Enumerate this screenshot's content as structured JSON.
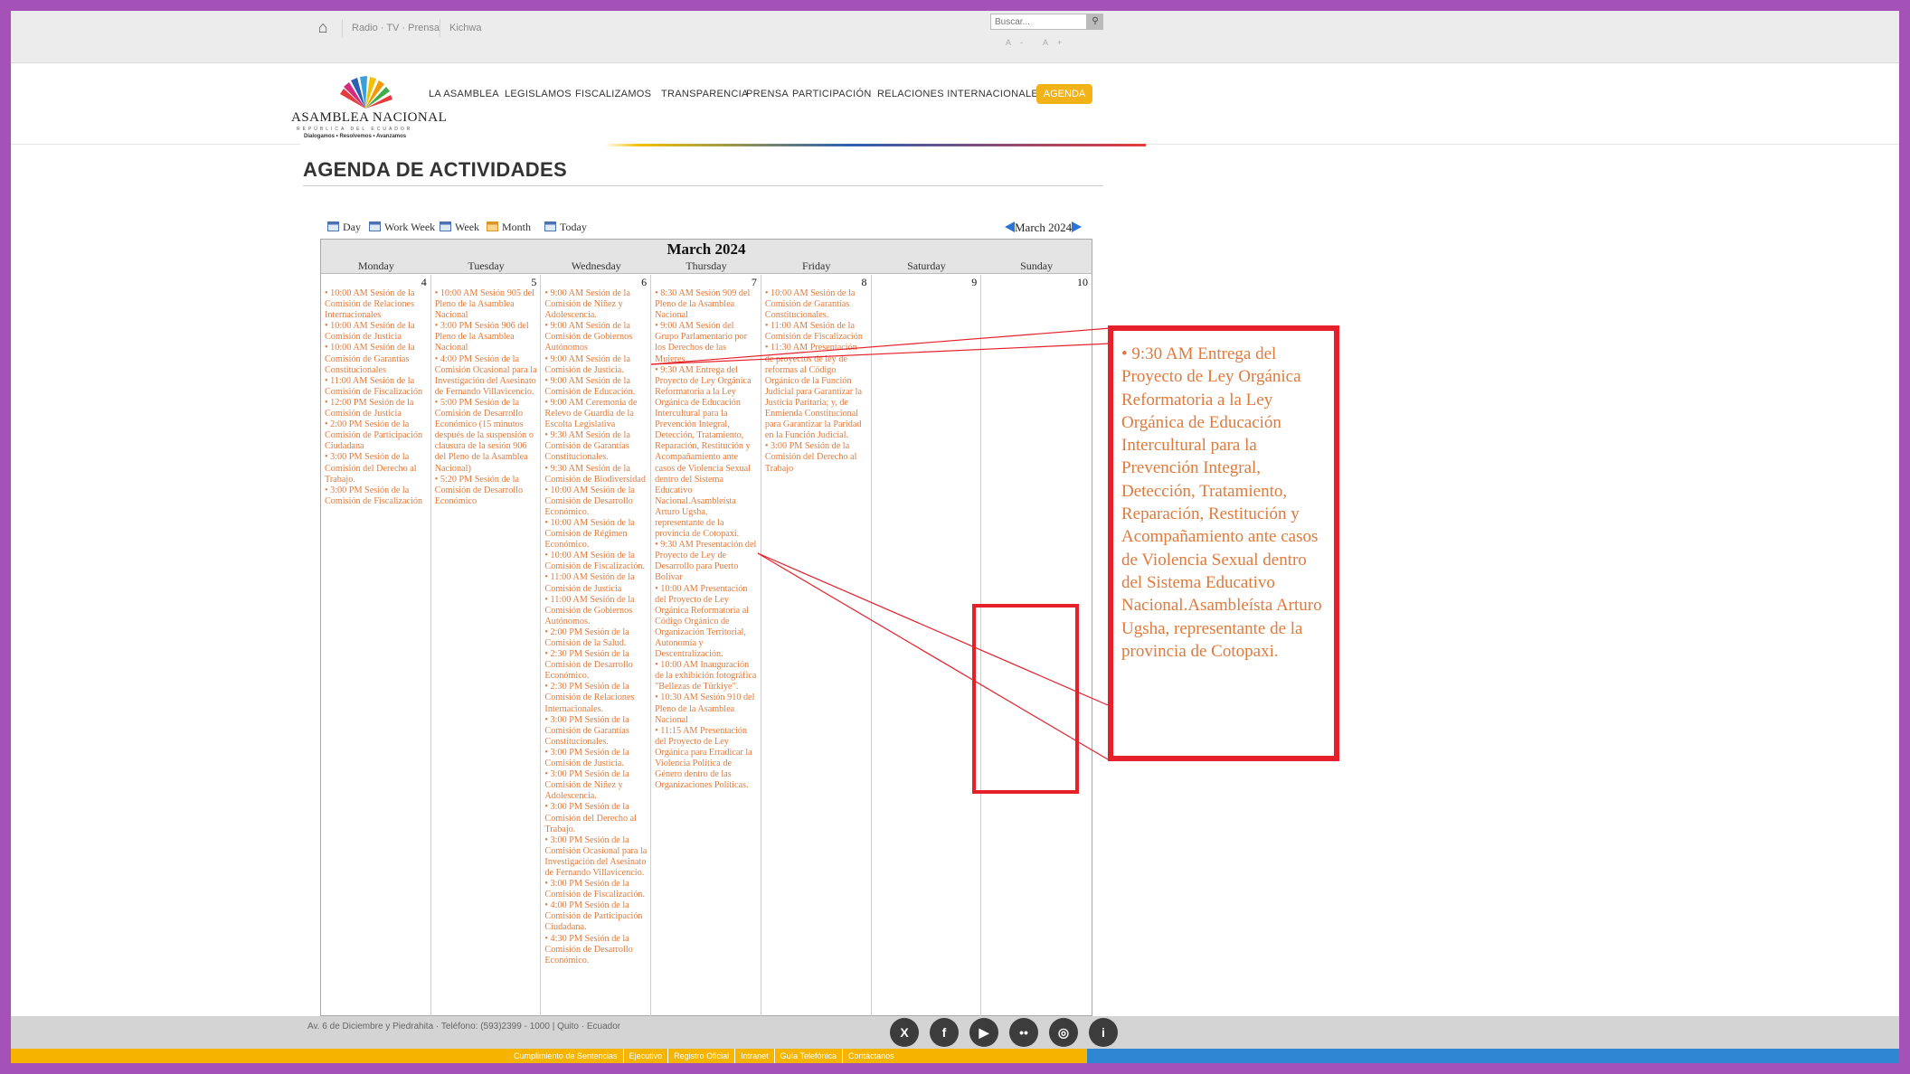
{
  "topbar": {
    "links": [
      "Radio · TV · Prensa",
      "Kichwa"
    ],
    "search_placeholder": "Buscar...",
    "font_size_controls": "A- A+"
  },
  "logo": {
    "title": "ASAMBLEA NACIONAL",
    "subtitle": "REPÚBLICA DEL ECUADOR",
    "tagline": "Dialogamos • Resolvemos • Avanzamos"
  },
  "nav": {
    "items": [
      "LA ASAMBLEA",
      "LEGISLAMOS",
      "FISCALIZAMOS",
      "TRANSPARENCIA",
      "PRENSA",
      "PARTICIPACIÓN",
      "RELACIONES INTERNACIONALES"
    ],
    "agenda": "AGENDA"
  },
  "page": {
    "title": "AGENDA DE ACTIVIDADES"
  },
  "calendar": {
    "views": [
      "Day",
      "Work Week",
      "Week",
      "Month",
      "Today"
    ],
    "nav_month": "March 2024",
    "month_title": "March 2024",
    "day_names": [
      "Monday",
      "Tuesday",
      "Wednesday",
      "Thursday",
      "Friday",
      "Saturday",
      "Sunday"
    ],
    "days": [
      {
        "num": "4",
        "events": [
          "10:00 AM   Sesión de la Comisión de Relaciones Internacionales",
          "10:00 AM   Sesión de la Comisión de Justicia",
          "10:00 AM   Sesión de la Comisión de Garantías Constitucionales",
          "11:00 AM   Sesión de la Comisión de Fiscalización",
          "12:00 PM   Sesión de la Comisión de Justicia",
          "2:00 PM   Sesión de la Comisión de Participación Ciudadana",
          "3:00 PM   Sesión de la Comisión del Derecho al Trabajo.",
          "3:00 PM   Sesión de la Comisión de Fiscalización"
        ]
      },
      {
        "num": "5",
        "events": [
          "10:00 AM   Sesión 905 del Pleno de la Asamblea Nacional",
          "3:00 PM   Sesión 906 del Pleno de la Asamblea Nacional",
          "4:00 PM   Sesión de la Comisión Ocasional para la Investigación del Asesinato de Fernando Villavicencio.",
          "5:00 PM   Sesión de la Comisión de Desarrollo Económico (15 minutos después de la suspensión o clausura de la sesión 906 del Pleno de la Asamblea Nacional)",
          "5:20 PM   Sesión de la Comisión de Desarrollo Económico"
        ]
      },
      {
        "num": "6",
        "events": [
          "9:00 AM   Sesión de la Comisión de Niñez y Adolescencia.",
          "9:00 AM   Sesión de la Comisión de Gobiernos Autónomos",
          "9:00 AM   Sesión de la Comisión de Justicia.",
          "9:00 AM   Sesión de la Comisión de Educación.",
          "9:00 AM   Ceremonia de Relevo de Guardia de la Escolta Legislativa",
          "9:30 AM   Sesión de la Comisión de Garantías Constitucionales.",
          "9:30 AM   Sesión de la Comisión de Biodiversidad",
          "10:00 AM   Sesión de la Comisión de Desarrollo Económico.",
          "10:00 AM   Sesión de la Comisión de Régimen Económico.",
          "10:00 AM   Sesión de la Comisión de Fiscalización.",
          "11:00 AM   Sesión de la Comisión de Justicia",
          "11:00 AM   Sesión de la Comisión de Gobiernos Autónomos.",
          "2:00 PM   Sesión de la Comisión de la Salud.",
          "2:30 PM   Sesión de la Comisión de Desarrollo Económico.",
          "2:30 PM   Sesión de la Comisión de Relaciones Internacionales.",
          "3:00 PM   Sesión de la Comisión de Garantías Constitucionales.",
          "3:00 PM   Sesión de la Comisión de Justicia.",
          "3:00 PM   Sesión de la Comisión de Niñez y Adolescencia.",
          "3:00 PM   Sesión de la Comisión del Derecho al Trabajo.",
          "3:00 PM   Sesión de la Comisión Ocasional para la Investigación del Asesinato de Fernando Villavicencio.",
          "3:00 PM   Sesión de la Comisión de Fiscalización.",
          "4:00 PM   Sesión de la Comisión de Participación Ciudadana.",
          "4:30 PM   Sesión de la Comisión de Desarrollo Económico."
        ]
      },
      {
        "num": "7",
        "events": [
          "8:30 AM   Sesión 909 del Pleno de la Asamblea Nacional",
          "9:00 AM   Sesión del Grupo Parlamentario por los Derechos de las Mujeres",
          "9:30 AM   Entrega del Proyecto de Ley Orgánica Reformatoria a la Ley Orgánica de Educación Intercultural para la Prevención Integral, Detección, Tratamiento, Reparación, Restitución y Acompañamiento ante casos de Violencia Sexual dentro del Sistema Educativo Nacional.Asambleísta Arturo Ugsha, representante de la provincia de Cotopaxi.",
          "9:30 AM   Presentación del Proyecto de Ley de Desarrollo para Puerto Bolívar",
          "10:00 AM   Presentación del Proyecto de Ley Orgánica Reformatoria al Código Orgánico de Organización Territorial, Autonomía y Descentralización.",
          "10:00 AM   Inauguración de la exhibición fotográfica \"Bellezas de Türkiye\".",
          "10:30 AM   Sesión 910 del Pleno de la Asamblea Nacional",
          "11:15 AM   Presentación del Proyecto de Ley Orgánica para Erradicar la Violencia Política de Género dentro de las Organizaciones Políticas."
        ]
      },
      {
        "num": "8",
        "events": [
          "10:00 AM   Sesión de la Comisión de Garantías Constitucionales.",
          "11:00 AM   Sesión de la Comisión de Fiscalización",
          "11:30 AM   Presentación de proyectos de ley de reformas al Código Orgánico de la Función Judicial para Garantizar la Justicia Paritaria; y, de Enmienda Constitucional para Garantizar la Paridad en la Función Judicial.",
          "3:00 PM   Sesión de la Comisión del Derecho al Trabajo"
        ]
      },
      {
        "num": "9",
        "events": []
      },
      {
        "num": "10",
        "events": []
      }
    ]
  },
  "callout": {
    "text": "9:30 AM   Entrega del Proyecto de Ley Orgánica Reformatoria a la Ley Orgánica de Educación Intercultural para la Prevención Integral, Detección, Tratamiento, Reparación, Restitución y Acompañamiento ante casos de Violencia Sexual dentro del Sistema Educativo Nacional.Asambleísta Arturo Ugsha, representante de la provincia de Cotopaxi.",
    "color": "#e5202a"
  },
  "footer": {
    "address": "Av. 6 de Diciembre y Piedrahita · Teléfono: (593)2399 - 1000  |  Quito · Ecuador",
    "social": [
      "x-icon",
      "facebook-icon",
      "youtube-icon",
      "flickr-icon",
      "instagram-icon",
      "info-icon"
    ],
    "links": [
      "Cumplimiento de Sentencias",
      "Ejecutivo",
      "Registro Oficial",
      "Intranet",
      "Guía Telefónica",
      "Contáctanos"
    ]
  },
  "colors": {
    "frame": "#a452b8",
    "event_text": "#e07a3c",
    "agenda_button": "#f2b318",
    "bar_yellow": "#f4b400",
    "bar_blue": "#2f86d2"
  }
}
